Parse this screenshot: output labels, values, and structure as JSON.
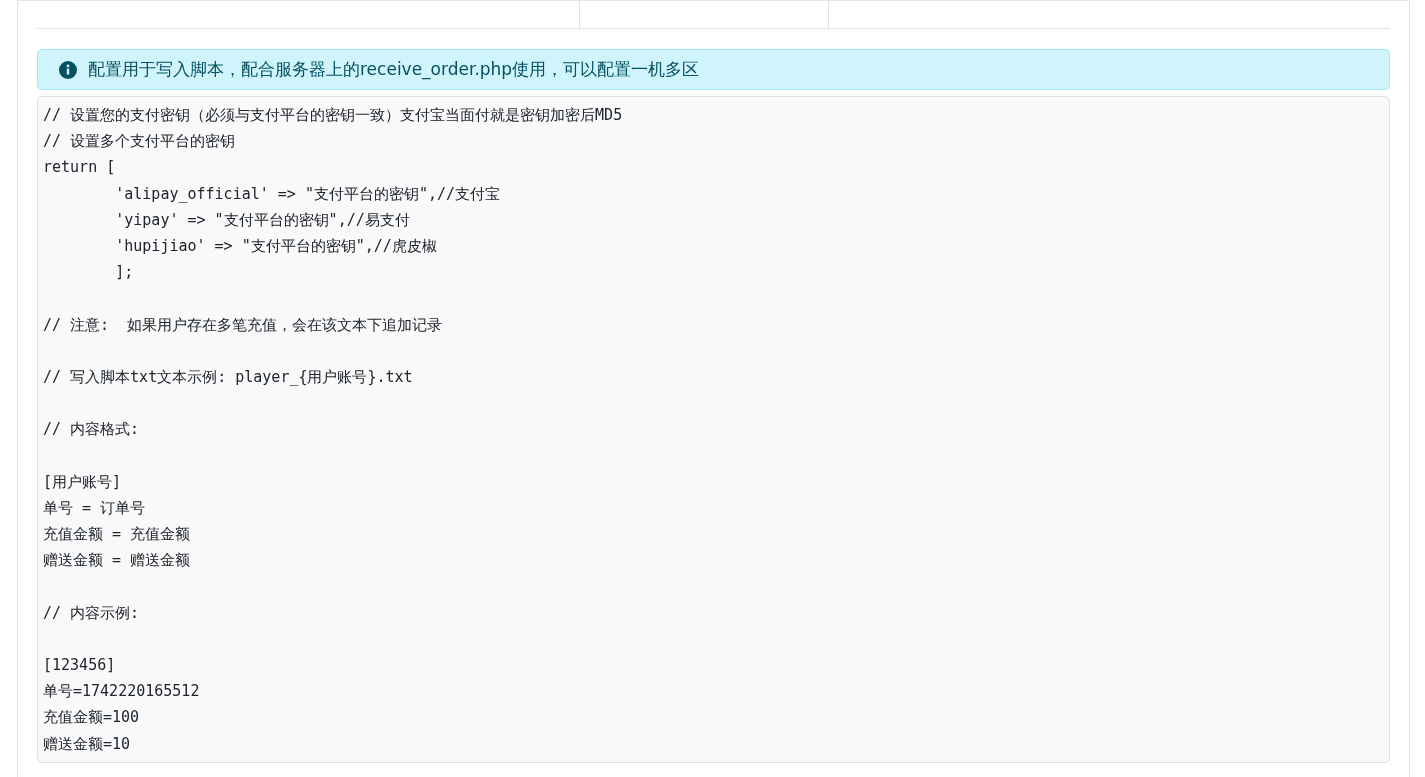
{
  "alert": {
    "text": "配置用于写入脚本，配合服务器上的receive_order.php使用，可以配置一机多区"
  },
  "code_blocks": [
    [
      "// 设置您的支付密钥（必须与支付平台的密钥一致）支付宝当面付就是密钥加密后MD5",
      "// 设置多个支付平台的密钥",
      "return [",
      "\t'alipay_official' => \"支付平台的密钥\",//支付宝",
      "\t'yipay' => \"支付平台的密钥\",//易支付",
      "\t'hupijiao' => \"支付平台的密钥\",//虎皮椒",
      "\t];"
    ],
    [
      "// 注意:  如果用户存在多笔充值，会在该文本下追加记录"
    ],
    [
      "// 写入脚本txt文本示例: player_{用户账号}.txt"
    ],
    [
      "// 内容格式:"
    ],
    [
      "[用户账号]",
      "单号 = 订单号",
      "充值金额 = 充值金额",
      "赠送金额 = 赠送金额"
    ],
    [
      "// 内容示例:"
    ],
    [
      "[123456]",
      "单号=1742220165512",
      "充值金额=100",
      "赠送金额=10"
    ]
  ]
}
